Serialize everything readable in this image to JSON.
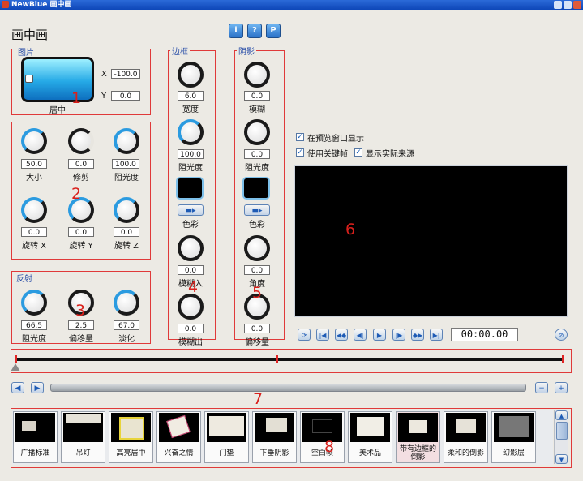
{
  "window": {
    "title": "NewBlue 画中画"
  },
  "heading": "画中画",
  "top_buttons": [
    "i",
    "?",
    "P"
  ],
  "sections": {
    "picture": {
      "label": "图片",
      "preview_caption": "居中",
      "x_label": "X",
      "x_value": "-100.0",
      "y_label": "Y",
      "y_value": "0.0",
      "marker": "1"
    },
    "transform": {
      "marker": "2",
      "row1": [
        {
          "value": "50.0",
          "label": "大小"
        },
        {
          "value": "0.0",
          "label": "修剪"
        },
        {
          "value": "100.0",
          "label": "阻光度"
        }
      ],
      "row2": [
        {
          "value": "0.0",
          "label": "旋转 X"
        },
        {
          "value": "0.0",
          "label": "旋转 Y"
        },
        {
          "value": "0.0",
          "label": "旋转 Z"
        }
      ]
    },
    "reflection": {
      "label": "反射",
      "marker": "3",
      "knobs": [
        {
          "value": "66.5",
          "label": "阻光度"
        },
        {
          "value": "2.5",
          "label": "偏移量"
        },
        {
          "value": "67.0",
          "label": "淡化"
        }
      ]
    },
    "border": {
      "label": "边框",
      "marker": "4",
      "width": {
        "value": "6.0",
        "label": "宽度"
      },
      "opacity": {
        "value": "100.0",
        "label": "阻光度"
      },
      "color_label": "色彩",
      "blur_in": {
        "value": "0.0",
        "label": "模糊入"
      },
      "blur_out": {
        "value": "0.0",
        "label": "模糊出"
      }
    },
    "shadow": {
      "label": "阴影",
      "marker": "5",
      "blur": {
        "value": "0.0",
        "label": "模糊"
      },
      "opacity": {
        "value": "0.0",
        "label": "阻光度"
      },
      "color_label": "色彩",
      "angle": {
        "value": "0.0",
        "label": "角度"
      },
      "offset": {
        "value": "0.0",
        "label": "偏移量"
      }
    }
  },
  "preview": {
    "show_in_preview": "在预览窗口显示",
    "use_keyframes": "使用关键帧",
    "show_source": "显示实际来源",
    "marker": "6",
    "timecode": "00:00.00"
  },
  "timeline_marker": "7",
  "presets": {
    "marker": "8",
    "items": [
      "广播标准",
      "吊灯",
      "高亮居中",
      "兴奋之情",
      "门垫",
      "下垂阴影",
      "空白帧",
      "美术品",
      "带有边框的倒影",
      "柔和的倒影",
      "幻影层"
    ]
  },
  "colors": {
    "accent": "#2b9be0",
    "marker": "#d9201c",
    "box": "#e03a3a"
  }
}
